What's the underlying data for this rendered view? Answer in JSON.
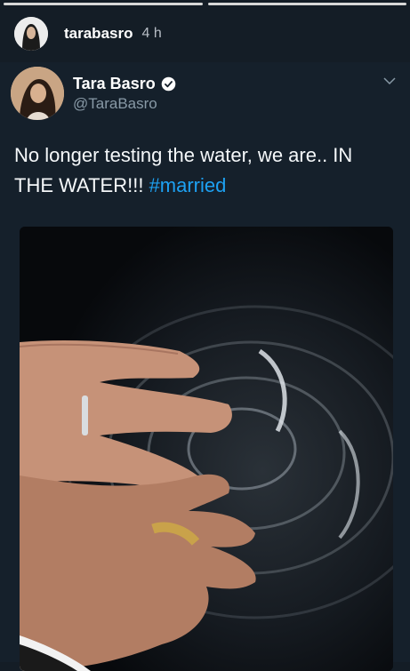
{
  "story": {
    "username": "tarabasro",
    "time_ago": "4 h"
  },
  "tweet": {
    "display_name": "Tara Basro",
    "handle": "@TaraBasro",
    "text": "No longer testing the water, we are.. IN THE WATER!!! ",
    "hashtag": "#married",
    "verified": true
  },
  "colors": {
    "background": "#141d26",
    "link": "#1da1f2",
    "muted": "#8899a6"
  }
}
